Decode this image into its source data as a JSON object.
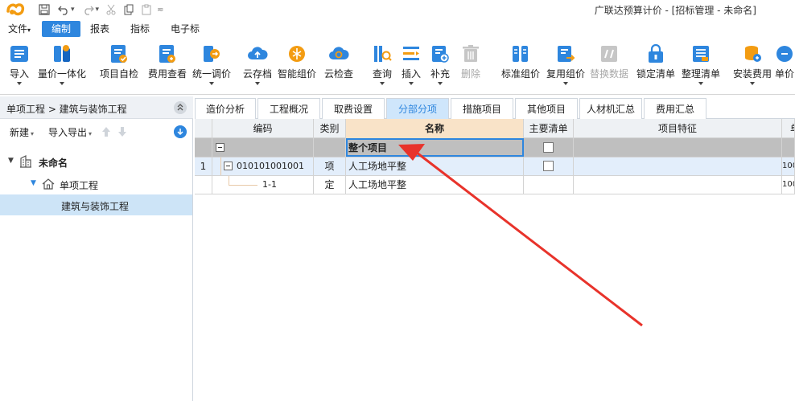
{
  "titlebar": {
    "app_title": "广联达预算计价 - [招标管理 - 未命名]",
    "qa_dropdown": "▾"
  },
  "menu": {
    "items": [
      {
        "label": "文件",
        "suffix": "▾"
      },
      {
        "label": "编制"
      },
      {
        "label": "报表"
      },
      {
        "label": "指标"
      },
      {
        "label": "电子标"
      }
    ]
  },
  "ribbon": {
    "buttons": [
      {
        "label": "导入",
        "icon": "import-icon",
        "caret": true
      },
      {
        "label": "量价一体化",
        "icon": "quantity-price-icon",
        "caret": true
      },
      {
        "label": "项目自检",
        "icon": "self-check-icon"
      },
      {
        "label": "费用查看",
        "icon": "fee-view-icon"
      },
      {
        "label": "统一调价",
        "icon": "adjust-price-icon",
        "caret": true
      },
      {
        "label": "云存档",
        "icon": "cloud-save-icon",
        "caret": true
      },
      {
        "label": "智能组价",
        "icon": "smart-price-icon"
      },
      {
        "label": "云检查",
        "icon": "cloud-check-icon"
      },
      {
        "label": "查询",
        "icon": "query-icon",
        "caret": true
      },
      {
        "label": "插入",
        "icon": "insert-icon",
        "caret": true
      },
      {
        "label": "补充",
        "icon": "supplement-icon",
        "caret": true
      },
      {
        "label": "删除",
        "icon": "delete-icon",
        "disabled": true
      },
      {
        "label": "标准组价",
        "icon": "standard-price-icon"
      },
      {
        "label": "复用组价",
        "icon": "reuse-price-icon",
        "caret": true
      },
      {
        "label": "替换数据",
        "icon": "replace-data-icon",
        "disabled": true
      },
      {
        "label": "锁定清单",
        "icon": "lock-list-icon"
      },
      {
        "label": "整理清单",
        "icon": "organize-list-icon",
        "caret": true
      },
      {
        "label": "安装费用",
        "icon": "install-fee-icon",
        "caret": true
      },
      {
        "label": "单价",
        "icon": "unit-price-icon"
      }
    ]
  },
  "leftpanel": {
    "breadcrumb": "单项工程 > 建筑与装饰工程",
    "new_label": "新建",
    "import_export_label": "导入导出",
    "dd": "▾",
    "tree": [
      {
        "label": "未命名",
        "icon": "building-icon",
        "level": 0
      },
      {
        "label": "单项工程",
        "icon": "home-icon",
        "level": 1
      },
      {
        "label": "建筑与装饰工程",
        "level": 2,
        "selected": true
      }
    ]
  },
  "tabs": {
    "items": [
      "造价分析",
      "工程概况",
      "取费设置",
      "分部分项",
      "措施项目",
      "其他项目",
      "人材机汇总",
      "费用汇总"
    ],
    "active_index": 3
  },
  "table": {
    "columns": [
      "",
      "编码",
      "类别",
      "名称",
      "主要清单",
      "项目特征",
      "单"
    ],
    "rows": [
      {
        "num": "",
        "code": "",
        "type": "",
        "name": "整个项目",
        "main": false,
        "feature": "",
        "unit": ""
      },
      {
        "num": "1",
        "code": "010101001001",
        "type": "项",
        "name": "人工场地平整",
        "main": false,
        "feature": "",
        "unit": "100"
      },
      {
        "num": "",
        "code": "1-1",
        "type": "定",
        "name": "人工场地平整",
        "main": null,
        "feature": "",
        "unit": "100"
      }
    ]
  },
  "colors": {
    "accent": "#2e86de",
    "annotation_arrow": "#e8332b"
  }
}
